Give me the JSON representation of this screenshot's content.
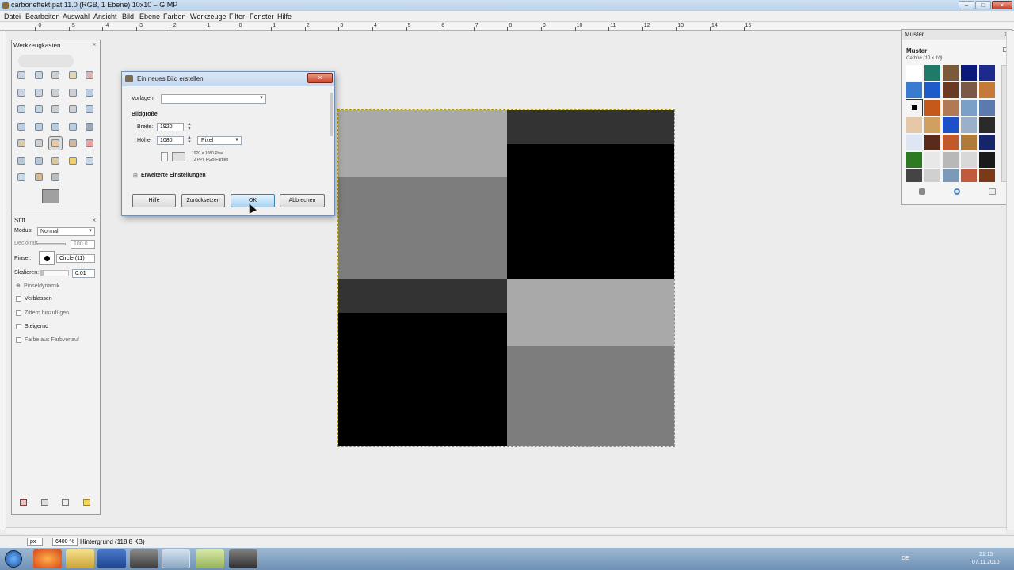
{
  "window": {
    "title": "carboneffekt.pat 11.0 (RGB, 1 Ebene) 10x10 – GIMP",
    "buttons": [
      "–",
      "□",
      "×"
    ]
  },
  "menu": [
    "Datei",
    "Bearbeiten",
    "Auswahl",
    "Ansicht",
    "Bild",
    "Ebene",
    "Farben",
    "Werkzeuge",
    "Filter",
    "Fenster",
    "Hilfe"
  ],
  "ruler": {
    "labels": [
      "-0",
      "-5",
      "-4",
      "-3",
      "-2",
      "-1",
      "0",
      "1",
      "2",
      "3",
      "4",
      "5",
      "6",
      "7",
      "8",
      "9",
      "10",
      "11",
      "12",
      "13",
      "14",
      "15"
    ]
  },
  "toolbox": {
    "title": "Werkzeugkasten",
    "close": "×",
    "tool_options_title": "Stift",
    "mode_label": "Modus:",
    "mode_value": "Normal",
    "opacity_label": "Deckkraft",
    "opacity_value": "100.0",
    "brush_label": "Pinsel:",
    "brush_value": "Circle (11)",
    "scale_label": "Skalieren:",
    "scale_value": "0.01",
    "dynamics_label": "Pinseldynamik",
    "fade_label": "Verblassen",
    "jitter_label": "Zittern hinzufügen",
    "incremental_label": "Steigernd",
    "gradient_label": "Farbe aus Farbverlauf"
  },
  "dialog": {
    "title": "Ein neues Bild erstellen",
    "close": "×",
    "template_label": "Vorlagen:",
    "template_value": "",
    "size_heading": "Bildgröße",
    "width_label": "Breite:",
    "width_value": "1920",
    "height_label": "Höhe:",
    "height_value": "1080",
    "unit_value": "Pixel",
    "info_line1": "1920 × 1080 Pixel",
    "info_line2": "72 PPI, RGB-Farben",
    "advanced_label": "Erweiterte Einstellungen",
    "buttons": {
      "help": "Hilfe",
      "reset": "Zurücksetzen",
      "ok": "OK",
      "cancel": "Abbrechen"
    }
  },
  "patterns": {
    "title": "Muster",
    "heading": "Muster",
    "selected": "Carbon (10 × 10)"
  },
  "statusbar": {
    "unit": "px",
    "zoom": "6400 %",
    "layer_info": "Hintergrund (118,8 KB)"
  },
  "taskbar": {
    "time": "21:15",
    "date": "07.11.2010",
    "lang": "DE"
  },
  "colors": {
    "canvas_light": "#a9a9a9",
    "canvas_mid": "#7d7d7d",
    "canvas_dark": "#333333",
    "canvas_black": "#000000",
    "ok_button": "#a9d3f2",
    "close_red": "#c8452b"
  }
}
